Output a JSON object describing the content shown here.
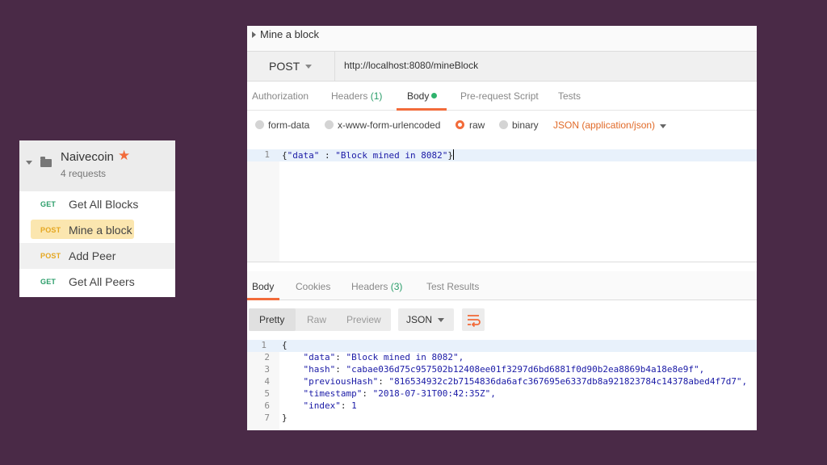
{
  "collection": {
    "name": "Naivecoin",
    "count": "4 requests",
    "requests": [
      {
        "method": "GET",
        "name": "Get All Blocks"
      },
      {
        "method": "POST",
        "name": "Mine a block"
      },
      {
        "method": "POST",
        "name": "Add Peer"
      },
      {
        "method": "GET",
        "name": "Get All Peers"
      }
    ]
  },
  "request": {
    "title": "Mine a block",
    "method": "POST",
    "url": "http://localhost:8080/mineBlock",
    "tabs": {
      "authorization": "Authorization",
      "headers": "Headers",
      "headers_count": "(1)",
      "body": "Body",
      "prerequest": "Pre-request Script",
      "tests": "Tests"
    },
    "body_types": {
      "form_data": "form-data",
      "urlencoded": "x-www-form-urlencoded",
      "raw": "raw",
      "binary": "binary",
      "content_type": "JSON (application/json)"
    },
    "body_lines": [
      {
        "num": "1",
        "open": "{",
        "key": "\"data\"",
        "sep": " : ",
        "val": "\"Block mined in 8082\"",
        "close": "}"
      }
    ]
  },
  "response": {
    "tabs": {
      "body": "Body",
      "cookies": "Cookies",
      "headers": "Headers",
      "headers_count": "(3)",
      "test_results": "Test Results"
    },
    "view_modes": {
      "pretty": "Pretty",
      "raw": "Raw",
      "preview": "Preview"
    },
    "format": "JSON",
    "lines": [
      {
        "num": "1",
        "text": "{"
      },
      {
        "num": "2",
        "key": "\"data\"",
        "val": "\"Block mined in 8082\","
      },
      {
        "num": "3",
        "key": "\"hash\"",
        "val": "\"cabae036d75c957502b12408ee01f3297d6bd6881f0d90b2ea8869b4a18e8e9f\","
      },
      {
        "num": "4",
        "key": "\"previousHash\"",
        "val": "\"816534932c2b7154836da6afc367695e6337db8a921823784c14378abed4f7d7\","
      },
      {
        "num": "5",
        "key": "\"timestamp\"",
        "val": "\"2018-07-31T00:42:35Z\","
      },
      {
        "num": "6",
        "key": "\"index\"",
        "val": "1"
      },
      {
        "num": "7",
        "text": "}"
      }
    ]
  },
  "colors": {
    "background": "#4a2a47",
    "accent": "#f26b3a",
    "get": "#2a9d69",
    "post": "#e5a721",
    "json_string": "#1a1aa6"
  }
}
